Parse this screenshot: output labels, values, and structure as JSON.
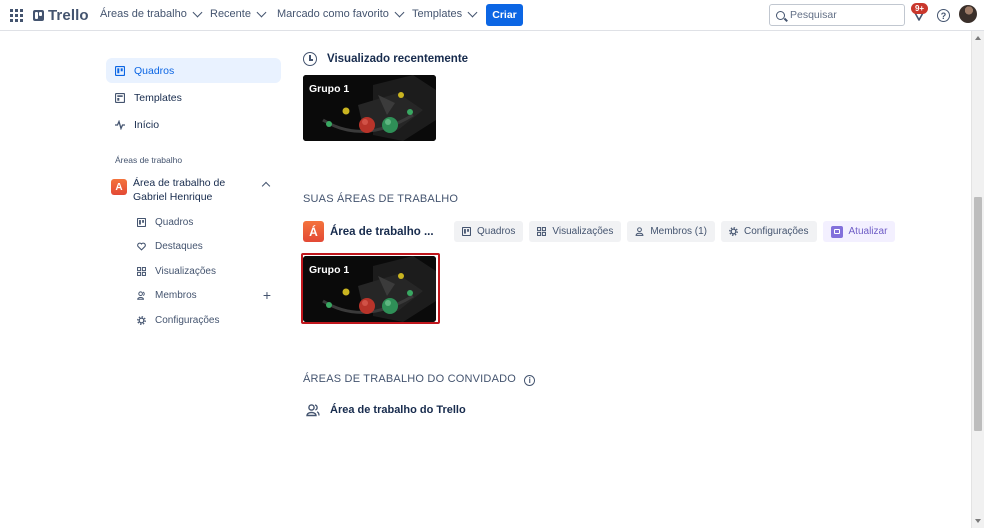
{
  "header": {
    "logo_text": "Trello",
    "menus": [
      {
        "label": "Áreas de trabalho"
      },
      {
        "label": "Recente"
      },
      {
        "label": "Marcado como favorito"
      },
      {
        "label": "Templates"
      }
    ],
    "create_label": "Criar",
    "search_placeholder": "Pesquisar",
    "notification_count": "9+",
    "help_glyph": "?"
  },
  "sidebar": {
    "items": [
      {
        "label": "Quadros",
        "icon": "board-icon",
        "active": true
      },
      {
        "label": "Templates",
        "icon": "template-icon"
      },
      {
        "label": "Início",
        "icon": "activity-icon"
      }
    ],
    "workspaces_label": "Áreas de trabalho",
    "workspace": {
      "initial": "A",
      "name": "Área de trabalho de Gabriel Henrique",
      "sub_items": [
        {
          "label": "Quadros",
          "icon": "board-icon"
        },
        {
          "label": "Destaques",
          "icon": "heart-icon"
        },
        {
          "label": "Visualizações",
          "icon": "grid-icon"
        },
        {
          "label": "Membros",
          "icon": "members-icon"
        },
        {
          "label": "Configurações",
          "icon": "gear-icon"
        }
      ]
    }
  },
  "main": {
    "recent_title": "Visualizado recentemente",
    "recent_board": {
      "title": "Grupo 1"
    },
    "your_workspaces_title": "SUAS ÁREAS DE TRABALHO",
    "workspace": {
      "initial": "Á",
      "title": "Área de trabalho ...",
      "actions": [
        {
          "label": "Quadros",
          "icon": "board-icon"
        },
        {
          "label": "Visualizações",
          "icon": "grid-icon"
        },
        {
          "label": "Membros (1)",
          "icon": "person-icon"
        },
        {
          "label": "Configurações",
          "icon": "gear-icon"
        }
      ],
      "upgrade_label": "Atualizar"
    },
    "workspace_board": {
      "title": "Grupo 1"
    },
    "guest_title": "ÁREAS DE TRABALHO DO CONVIDADO",
    "guest_workspace": "Área de trabalho do Trello"
  },
  "colors": {
    "primary": "#0c66e4",
    "workspace_badge": "#e34935",
    "highlight": "#c0171d",
    "notification": "#c9372c"
  }
}
